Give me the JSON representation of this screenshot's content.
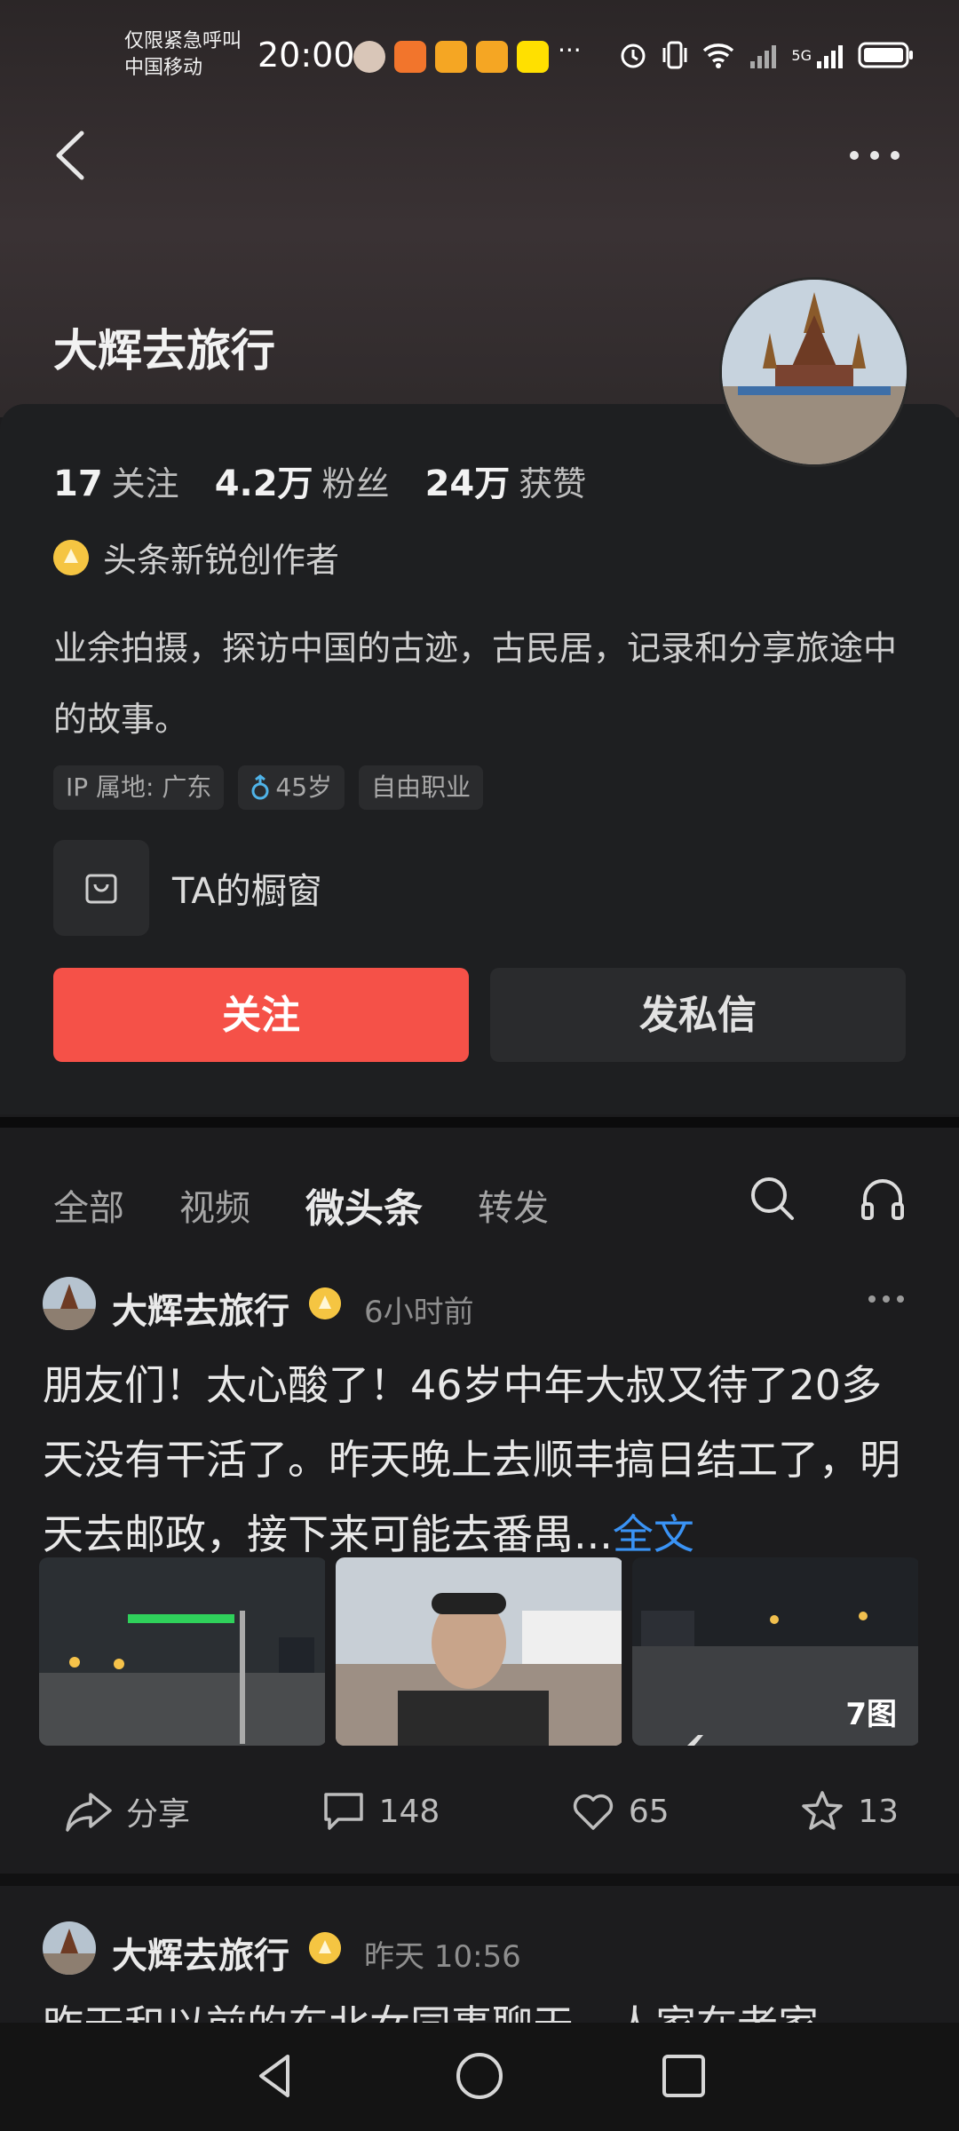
{
  "status_bar": {
    "carrier_line1": "仅限紧急呼叫",
    "carrier_line2": "中国移动",
    "time": "20:00",
    "more": "···",
    "network": "5G"
  },
  "profile": {
    "name": "大辉去旅行",
    "following_count": "17",
    "following_label": "关注",
    "followers_count": "4.2万",
    "followers_label": "粉丝",
    "likes_count": "24万",
    "likes_label": "获赞",
    "badge_text": "头条新锐创作者",
    "bio": "业余拍摄，探访中国的古迹，古民居，记录和分享旅途中的故事。",
    "tags": [
      "IP 属地: 广东",
      "45岁",
      "自由职业"
    ],
    "shop_label": "TA的橱窗",
    "follow_button": "关注",
    "message_button": "发私信"
  },
  "tabs": [
    "全部",
    "视频",
    "微头条",
    "转发"
  ],
  "active_tab": "微头条",
  "posts": [
    {
      "author": "大辉去旅行",
      "time": "6小时前",
      "text": "朋友们！太心酸了！46岁中年大叔又待了20多天没有干活了。昨天晚上去顺丰搞日结工了，明天去邮政，接下来可能去番禺...",
      "full_link": "全文",
      "image_count": "7图",
      "share_label": "分享",
      "comments": "148",
      "likes": "65",
      "favorites": "13"
    },
    {
      "author": "大辉去旅行",
      "time": "昨天  10:56",
      "text": "昨天和以前的东北女同事聊天，人家在老家"
    }
  ],
  "colors": {
    "accent_follow": "#f55148",
    "link_blue": "#3a93f5",
    "badge_gold": "#f5c542"
  }
}
